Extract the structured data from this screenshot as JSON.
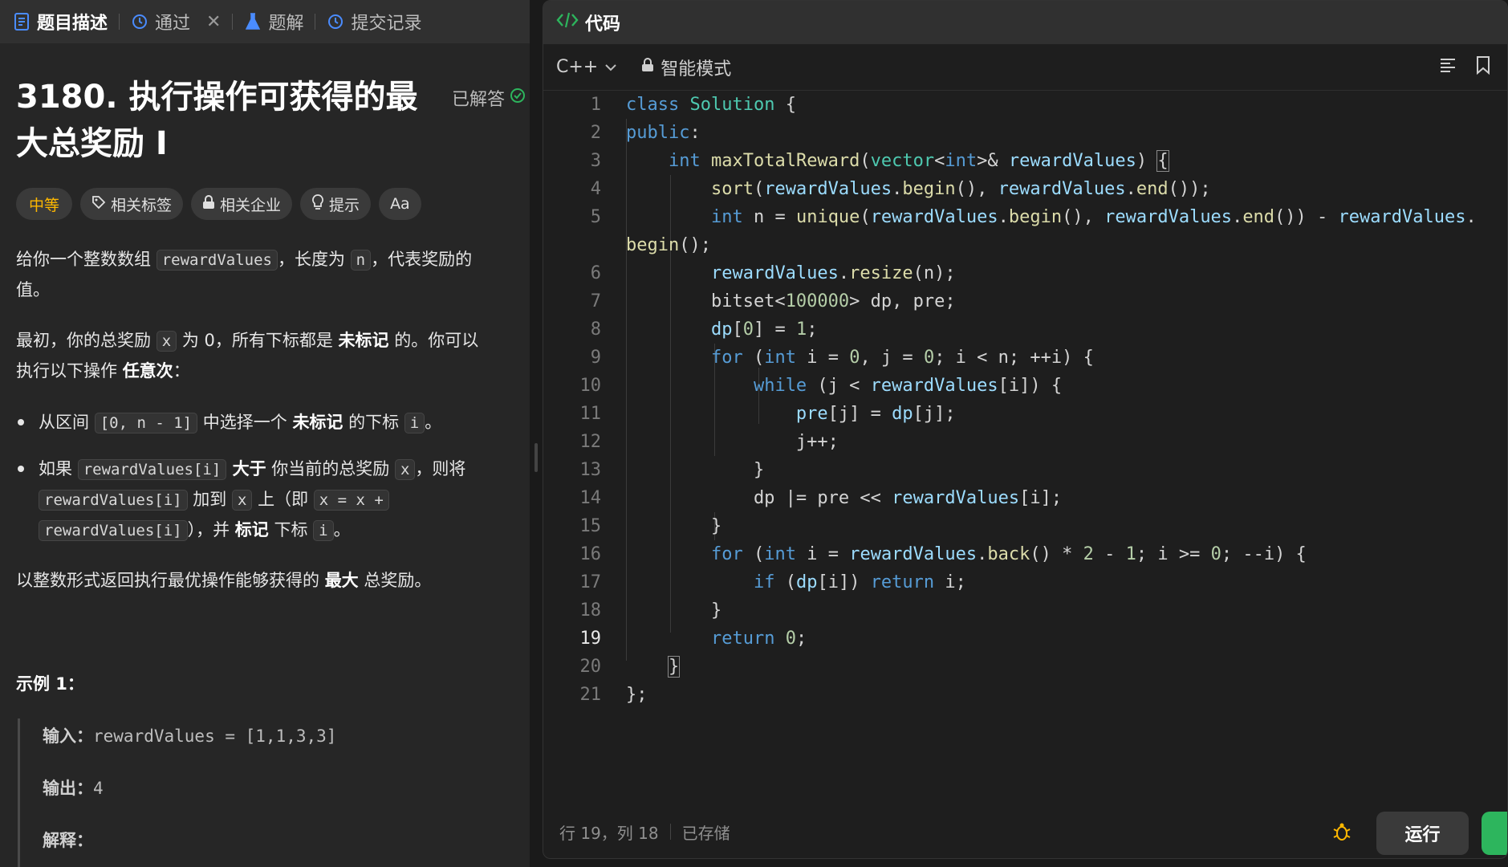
{
  "left_tabs": [
    {
      "label": "题目描述",
      "icon": "document-icon"
    },
    {
      "label": "通过",
      "icon": "history-icon"
    },
    {
      "label": "题解",
      "icon": "flask-icon"
    },
    {
      "label": "提交记录",
      "icon": "history-icon"
    }
  ],
  "problem": {
    "title_line1": "3180. 执行操作可获得的最",
    "title_line2": "大总奖励 I",
    "solved_label": "已解答",
    "tags": {
      "difficulty": "中等",
      "related_tags": "相关标签",
      "related_companies": "相关企业",
      "hint": "提示",
      "font": "Aa"
    },
    "desc1": {
      "t1": "给你一个整数数组 ",
      "c1": "rewardValues",
      "t2": "，长度为 ",
      "c2": "n",
      "t3": "，代表奖励的",
      "t4": "值。"
    },
    "desc2": {
      "t1": "最初，你的总奖励 ",
      "c1": "x",
      "t2": " 为 0，所有下标都是 ",
      "b1": "未标记",
      "t3": " 的。你可以",
      "t4": "执行以下操作 ",
      "b2": "任意次",
      "t5": "："
    },
    "bullet1": {
      "t1": "从区间 ",
      "c1": "[0, n - 1]",
      "t2": " 中选择一个 ",
      "b1": "未标记",
      "t3": " 的下标 ",
      "c2": "i",
      "t4": "。"
    },
    "bullet2": {
      "t1": "如果 ",
      "c1": "rewardValues[i]",
      "b1": " 大于",
      "t2": " 你当前的总奖励 ",
      "c2": "x",
      "t3": "，则将",
      "c3": "rewardValues[i]",
      "t4": " 加到 ",
      "c4": "x",
      "t5": " 上（即 ",
      "c5": "x = x +",
      "c6": "rewardValues[i]",
      "t6": "），并 ",
      "b2": "标记",
      "t7": " 下标 ",
      "c7": "i",
      "t8": "。"
    },
    "desc3": {
      "t1": "以整数形式返回执行最优操作能够获得的 ",
      "b1": "最大",
      "t2": " 总奖励。"
    },
    "example_title": "示例 1：",
    "example": {
      "input_label": "输入：",
      "input_value": "rewardValues = [1,1,3,3]",
      "output_label": "输出：",
      "output_value": "4",
      "explain_label": "解释："
    }
  },
  "editor": {
    "title": "代码",
    "language": "C++",
    "mode": "智能模式",
    "current_line": 19,
    "lines": [
      "1",
      "2",
      "3",
      "4",
      "5",
      "6",
      "7",
      "8",
      "9",
      "10",
      "11",
      "12",
      "13",
      "14",
      "15",
      "16",
      "17",
      "18",
      "19",
      "20",
      "21"
    ]
  },
  "status": {
    "position": "行 19，列 18",
    "saved": "已存储",
    "run_label": "运行"
  }
}
